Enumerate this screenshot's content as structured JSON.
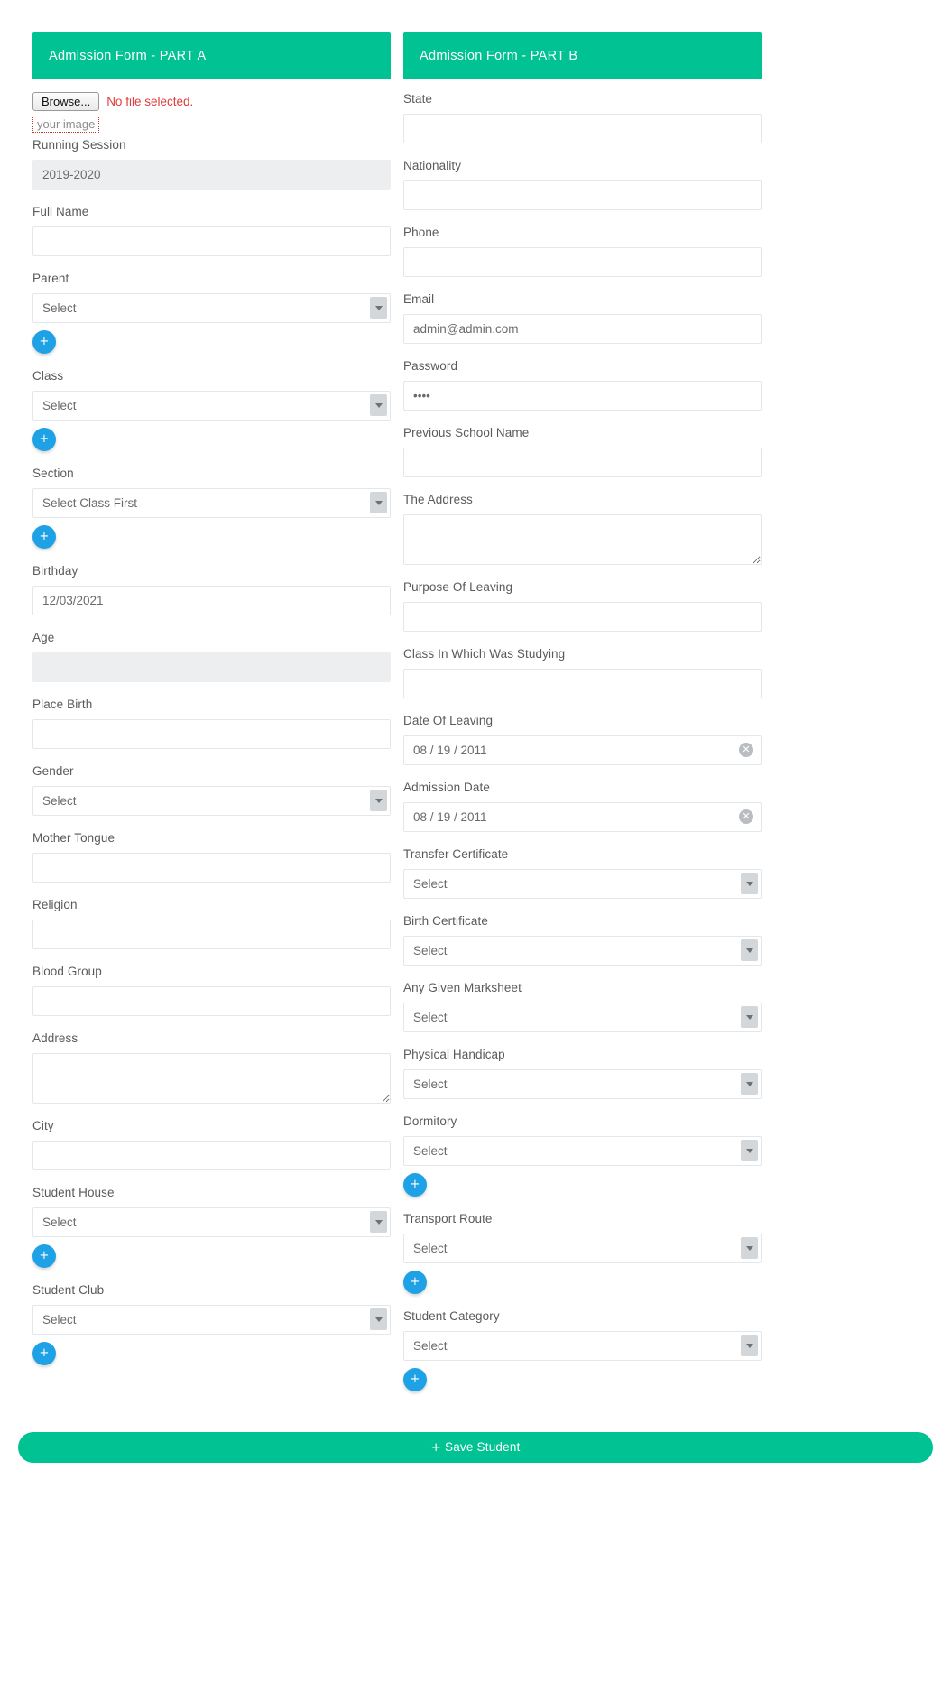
{
  "partA": {
    "header": "Admission Form - PART A",
    "file": {
      "browse_label": "Browse...",
      "no_file_text": "No file selected.",
      "hint": "your image"
    },
    "fields": [
      {
        "key": "running_session",
        "label": "Running Session",
        "type": "readonly",
        "value": "2019-2020"
      },
      {
        "key": "full_name",
        "label": "Full Name",
        "type": "text",
        "value": ""
      },
      {
        "key": "parent",
        "label": "Parent",
        "type": "select",
        "value": "Select",
        "add": true
      },
      {
        "key": "class",
        "label": "Class",
        "type": "select",
        "value": "Select",
        "add": true
      },
      {
        "key": "section",
        "label": "Section",
        "type": "select",
        "value": "Select Class First",
        "add": true
      },
      {
        "key": "birthday",
        "label": "Birthday",
        "type": "text",
        "value": "12/03/2021"
      },
      {
        "key": "age",
        "label": "Age",
        "type": "readonly",
        "value": ""
      },
      {
        "key": "place_birth",
        "label": "Place Birth",
        "type": "text",
        "value": ""
      },
      {
        "key": "gender",
        "label": "Gender",
        "type": "select",
        "value": "Select",
        "add": false
      },
      {
        "key": "mother_tongue",
        "label": "Mother Tongue",
        "type": "text",
        "value": ""
      },
      {
        "key": "religion",
        "label": "Religion",
        "type": "text",
        "value": ""
      },
      {
        "key": "blood_group",
        "label": "Blood Group",
        "type": "text",
        "value": ""
      },
      {
        "key": "address",
        "label": "Address",
        "type": "textarea",
        "value": ""
      },
      {
        "key": "city",
        "label": "City",
        "type": "text",
        "value": ""
      },
      {
        "key": "student_house",
        "label": "Student House",
        "type": "select",
        "value": "Select",
        "add": true
      },
      {
        "key": "student_club",
        "label": "Student Club",
        "type": "select",
        "value": "Select",
        "add": true
      }
    ]
  },
  "partB": {
    "header": "Admission Form - PART B",
    "fields": [
      {
        "key": "state",
        "label": "State",
        "type": "text",
        "value": ""
      },
      {
        "key": "nationality",
        "label": "Nationality",
        "type": "text",
        "value": ""
      },
      {
        "key": "phone",
        "label": "Phone",
        "type": "text",
        "value": ""
      },
      {
        "key": "email",
        "label": "Email",
        "type": "text",
        "value": "admin@admin.com"
      },
      {
        "key": "password",
        "label": "Password",
        "type": "password",
        "value": "••••"
      },
      {
        "key": "previous_school_name",
        "label": "Previous School Name",
        "type": "text",
        "value": ""
      },
      {
        "key": "the_address",
        "label": "The Address",
        "type": "textarea",
        "value": ""
      },
      {
        "key": "purpose_of_leaving",
        "label": "Purpose Of Leaving",
        "type": "text",
        "value": ""
      },
      {
        "key": "class_in_which_was_studying",
        "label": "Class In Which Was Studying",
        "type": "text",
        "value": ""
      },
      {
        "key": "date_of_leaving",
        "label": "Date Of Leaving",
        "type": "date",
        "value": "08 / 19 / 2011"
      },
      {
        "key": "admission_date",
        "label": "Admission Date",
        "type": "date",
        "value": "08 / 19 / 2011"
      },
      {
        "key": "transfer_certificate",
        "label": "Transfer Certificate",
        "type": "select",
        "value": "Select",
        "add": false
      },
      {
        "key": "birth_certificate",
        "label": "Birth Certificate",
        "type": "select",
        "value": "Select",
        "add": false
      },
      {
        "key": "any_given_marksheet",
        "label": "Any Given Marksheet",
        "type": "select",
        "value": "Select",
        "add": false
      },
      {
        "key": "physical_handicap",
        "label": "Physical Handicap",
        "type": "select",
        "value": "Select",
        "add": false
      },
      {
        "key": "dormitory",
        "label": "Dormitory",
        "type": "select",
        "value": "Select",
        "add": true
      },
      {
        "key": "transport_route",
        "label": "Transport Route",
        "type": "select",
        "value": "Select",
        "add": true
      },
      {
        "key": "student_category",
        "label": "Student Category",
        "type": "select",
        "value": "Select",
        "add": true
      }
    ]
  },
  "footer": {
    "save_label": "Save Student",
    "save_icon": "plus-icon"
  },
  "icons": {
    "plus": "+",
    "clear": "⊗"
  },
  "colors": {
    "header_green": "#00c292",
    "add_blue": "#1fa2e5",
    "error_red": "#e03c3c"
  }
}
